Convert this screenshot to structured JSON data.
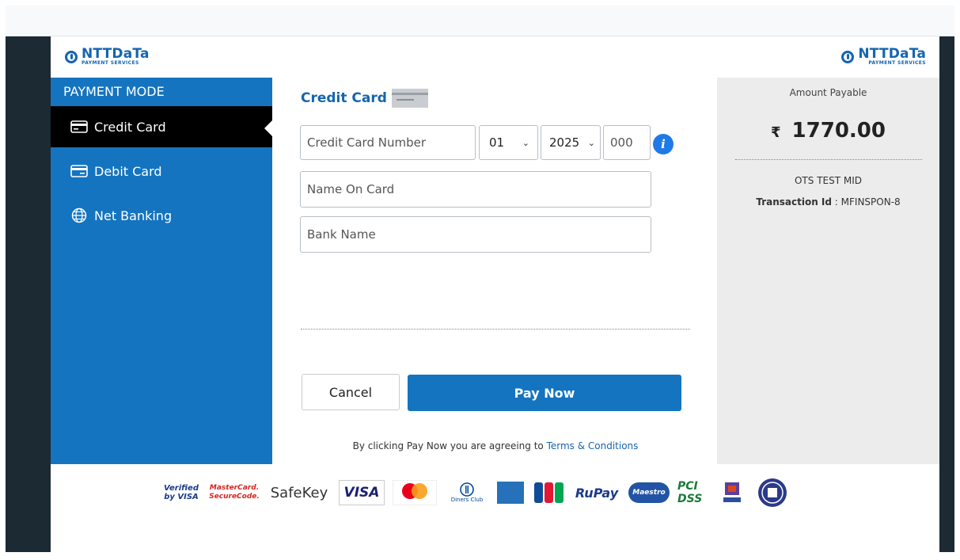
{
  "brand": {
    "name": "NTTDaTa",
    "tagline": "PAYMENT SERVICES"
  },
  "sidebar": {
    "title": "PAYMENT MODE",
    "items": [
      {
        "label": "Credit Card",
        "icon": "credit-card-icon",
        "active": true
      },
      {
        "label": "Debit Card",
        "icon": "debit-card-icon",
        "active": false
      },
      {
        "label": "Net Banking",
        "icon": "globe-icon",
        "active": false
      }
    ]
  },
  "form": {
    "title": "Credit Card",
    "card_number_placeholder": "Credit Card Number",
    "expiry_month": "01",
    "expiry_year": "2025",
    "cvv_placeholder": "000",
    "name_placeholder": "Name On Card",
    "bank_placeholder": "Bank Name",
    "info_icon_text": "i"
  },
  "actions": {
    "cancel_label": "Cancel",
    "pay_label": "Pay Now"
  },
  "terms": {
    "prefix": "By clicking Pay Now you are agreeing to ",
    "link": "Terms & Conditions"
  },
  "summary": {
    "amount_label": "Amount Payable",
    "currency_symbol": "₹",
    "amount": "1770.00",
    "merchant": "OTS TEST MID",
    "txn_label": "Transaction Id",
    "txn_id": " : MFINSPON-8"
  },
  "badges": {
    "verified_visa": "Verified by VISA",
    "mastercard": "MasterCard. SecureCode.",
    "safekey": "SafeKey",
    "visa": "VISA",
    "diners": "Diners Club",
    "rupay": "RuPay",
    "maestro": "Maestro",
    "pci": "PCI DSS"
  },
  "colors": {
    "primary": "#1474c0",
    "sidebar_active": "#000000",
    "panel_bg": "#ececec",
    "frame": "#1b2a33"
  }
}
